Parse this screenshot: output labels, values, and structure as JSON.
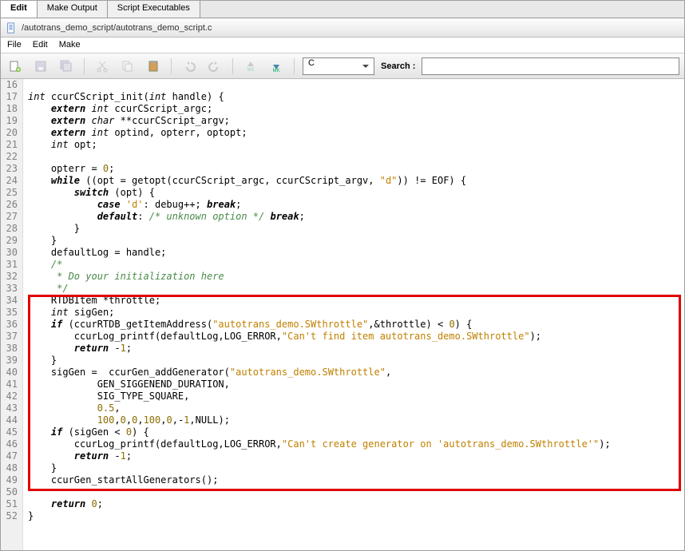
{
  "tabs": {
    "edit": "Edit",
    "make": "Make Output",
    "script": "Script Executables"
  },
  "path": "/autotrans_demo_script/autotrans_demo_script.c",
  "menu": {
    "file": "File",
    "edit": "Edit",
    "make": "Make"
  },
  "mode": "C",
  "search_label": "Search :",
  "search_value": "",
  "lines": {
    "start": 16,
    "rows": [
      {
        "n": 16,
        "t": ""
      },
      {
        "n": 17,
        "t": "int ccurCScript_init(int handle) {",
        "seg": [
          {
            "c": "type",
            "t": "int"
          },
          {
            "t": " ccurCScript_init("
          },
          {
            "c": "type",
            "t": "int"
          },
          {
            "t": " handle) {"
          }
        ]
      },
      {
        "n": 18,
        "t": "    extern int ccurCScript_argc;",
        "seg": [
          {
            "t": "    "
          },
          {
            "c": "kw",
            "t": "extern"
          },
          {
            "t": " "
          },
          {
            "c": "type",
            "t": "int"
          },
          {
            "t": " ccurCScript_argc;"
          }
        ]
      },
      {
        "n": 19,
        "t": "    extern char **ccurCScript_argv;",
        "seg": [
          {
            "t": "    "
          },
          {
            "c": "kw",
            "t": "extern"
          },
          {
            "t": " "
          },
          {
            "c": "type",
            "t": "char"
          },
          {
            "t": " **ccurCScript_argv;"
          }
        ]
      },
      {
        "n": 20,
        "t": "    extern int optind, opterr, optopt;",
        "seg": [
          {
            "t": "    "
          },
          {
            "c": "kw",
            "t": "extern"
          },
          {
            "t": " "
          },
          {
            "c": "type",
            "t": "int"
          },
          {
            "t": " optind, opterr, optopt;"
          }
        ]
      },
      {
        "n": 21,
        "t": "    int opt;",
        "seg": [
          {
            "t": "    "
          },
          {
            "c": "type",
            "t": "int"
          },
          {
            "t": " opt;"
          }
        ]
      },
      {
        "n": 22,
        "t": ""
      },
      {
        "n": 23,
        "t": "    opterr = 0;",
        "seg": [
          {
            "t": "    opterr = "
          },
          {
            "c": "num",
            "t": "0"
          },
          {
            "t": ";"
          }
        ]
      },
      {
        "n": 24,
        "t": "    while ((opt = getopt(ccurCScript_argc, ccurCScript_argv, \"d\")) != EOF) {",
        "seg": [
          {
            "t": "    "
          },
          {
            "c": "kw",
            "t": "while"
          },
          {
            "t": " ((opt = getopt(ccurCScript_argc, ccurCScript_argv, "
          },
          {
            "c": "str",
            "t": "\"d\""
          },
          {
            "t": ")) != EOF) {"
          }
        ]
      },
      {
        "n": 25,
        "t": "        switch (opt) {",
        "seg": [
          {
            "t": "        "
          },
          {
            "c": "kw",
            "t": "switch"
          },
          {
            "t": " (opt) {"
          }
        ]
      },
      {
        "n": 26,
        "t": "            case 'd': debug++; break;",
        "seg": [
          {
            "t": "            "
          },
          {
            "c": "kw",
            "t": "case"
          },
          {
            "t": " "
          },
          {
            "c": "str",
            "t": "'d'"
          },
          {
            "t": ": debug++; "
          },
          {
            "c": "kw",
            "t": "break"
          },
          {
            "t": ";"
          }
        ]
      },
      {
        "n": 27,
        "t": "            default: /* unknown option */ break;",
        "seg": [
          {
            "t": "            "
          },
          {
            "c": "kw",
            "t": "default"
          },
          {
            "t": ": "
          },
          {
            "c": "com",
            "t": "/* unknown option */"
          },
          {
            "t": " "
          },
          {
            "c": "kw",
            "t": "break"
          },
          {
            "t": ";"
          }
        ]
      },
      {
        "n": 28,
        "t": "        }"
      },
      {
        "n": 29,
        "t": "    }"
      },
      {
        "n": 30,
        "t": "    defaultLog = handle;"
      },
      {
        "n": 31,
        "t": "    /*",
        "seg": [
          {
            "t": "    "
          },
          {
            "c": "com",
            "t": "/*"
          }
        ]
      },
      {
        "n": 32,
        "t": "     * Do your initialization here",
        "seg": [
          {
            "t": "     "
          },
          {
            "c": "com",
            "t": "* Do your initialization here"
          }
        ]
      },
      {
        "n": 33,
        "t": "     */",
        "seg": [
          {
            "t": "     "
          },
          {
            "c": "com",
            "t": "*/"
          }
        ]
      },
      {
        "n": 34,
        "t": "    RTDBItem *throttle;"
      },
      {
        "n": 35,
        "t": "    int sigGen;",
        "seg": [
          {
            "t": "    "
          },
          {
            "c": "type",
            "t": "int"
          },
          {
            "t": " sigGen;"
          }
        ]
      },
      {
        "n": 36,
        "t": "    if (ccurRTDB_getItemAddress(\"autotrans_demo.SWthrottle\",&throttle) < 0) {",
        "seg": [
          {
            "t": "    "
          },
          {
            "c": "kw",
            "t": "if"
          },
          {
            "t": " (ccurRTDB_getItemAddress("
          },
          {
            "c": "str",
            "t": "\"autotrans_demo.SWthrottle\""
          },
          {
            "t": ",&throttle) < "
          },
          {
            "c": "num",
            "t": "0"
          },
          {
            "t": ") {"
          }
        ]
      },
      {
        "n": 37,
        "t": "        ccurLog_printf(defaultLog,LOG_ERROR,\"Can't find item autotrans_demo.SWthrottle\");",
        "seg": [
          {
            "t": "        ccurLog_printf(defaultLog,LOG_ERROR,"
          },
          {
            "c": "str",
            "t": "\"Can't find item autotrans_demo.SWthrottle\""
          },
          {
            "t": ");"
          }
        ]
      },
      {
        "n": 38,
        "t": "        return -1;",
        "seg": [
          {
            "t": "        "
          },
          {
            "c": "kw",
            "t": "return"
          },
          {
            "t": " -"
          },
          {
            "c": "num",
            "t": "1"
          },
          {
            "t": ";"
          }
        ]
      },
      {
        "n": 39,
        "t": "    }"
      },
      {
        "n": 40,
        "t": "    sigGen =  ccurGen_addGenerator(\"autotrans_demo.SWthrottle\",",
        "seg": [
          {
            "t": "    sigGen =  ccurGen_addGenerator("
          },
          {
            "c": "str",
            "t": "\"autotrans_demo.SWthrottle\""
          },
          {
            "t": ","
          }
        ]
      },
      {
        "n": 41,
        "t": "            GEN_SIGGENEND_DURATION,"
      },
      {
        "n": 42,
        "t": "            SIG_TYPE_SQUARE,"
      },
      {
        "n": 43,
        "t": "            0.5,",
        "seg": [
          {
            "t": "            "
          },
          {
            "c": "num",
            "t": "0.5"
          },
          {
            "t": ","
          }
        ]
      },
      {
        "n": 44,
        "t": "            100,0,0,100,0,-1,NULL);",
        "seg": [
          {
            "t": "            "
          },
          {
            "c": "num",
            "t": "100"
          },
          {
            "t": ","
          },
          {
            "c": "num",
            "t": "0"
          },
          {
            "t": ","
          },
          {
            "c": "num",
            "t": "0"
          },
          {
            "t": ","
          },
          {
            "c": "num",
            "t": "100"
          },
          {
            "t": ","
          },
          {
            "c": "num",
            "t": "0"
          },
          {
            "t": ",-"
          },
          {
            "c": "num",
            "t": "1"
          },
          {
            "t": ",NULL);"
          }
        ]
      },
      {
        "n": 45,
        "t": "    if (sigGen < 0) {",
        "seg": [
          {
            "t": "    "
          },
          {
            "c": "kw",
            "t": "if"
          },
          {
            "t": " (sigGen < "
          },
          {
            "c": "num",
            "t": "0"
          },
          {
            "t": ") {"
          }
        ]
      },
      {
        "n": 46,
        "t": "        ccurLog_printf(defaultLog,LOG_ERROR,\"Can't create generator on 'autotrans_demo.SWthrottle'\");",
        "seg": [
          {
            "t": "        ccurLog_printf(defaultLog,LOG_ERROR,"
          },
          {
            "c": "str",
            "t": "\"Can't create generator on 'autotrans_demo.SWthrottle'\""
          },
          {
            "t": ");"
          }
        ]
      },
      {
        "n": 47,
        "t": "        return -1;",
        "seg": [
          {
            "t": "        "
          },
          {
            "c": "kw",
            "t": "return"
          },
          {
            "t": " -"
          },
          {
            "c": "num",
            "t": "1"
          },
          {
            "t": ";"
          }
        ]
      },
      {
        "n": 48,
        "t": "    }"
      },
      {
        "n": 49,
        "t": "    ccurGen_startAllGenerators();"
      },
      {
        "n": 50,
        "t": ""
      },
      {
        "n": 51,
        "t": "    return 0;",
        "seg": [
          {
            "t": "    "
          },
          {
            "c": "kw",
            "t": "return"
          },
          {
            "t": " "
          },
          {
            "c": "num",
            "t": "0"
          },
          {
            "t": ";"
          }
        ]
      },
      {
        "n": 52,
        "t": "}"
      }
    ]
  }
}
